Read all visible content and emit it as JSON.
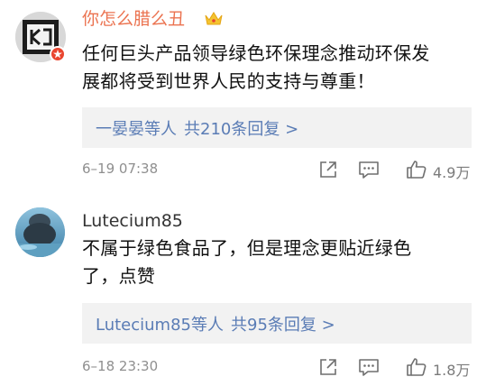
{
  "comments": [
    {
      "username": "你怎么腊么丑",
      "body_lines": [
        "任何巨头产品领导绿色环保理念推动环保发",
        "展都将受到世界人民的支持与尊重！"
      ],
      "reply_by": "一晏晏等人",
      "reply_count": "共210条回复 >",
      "time": "6–19 07:38",
      "likes": "4.9万"
    },
    {
      "username": "Lutecium85",
      "body_lines": [
        "不属于绿色食品了，但是理念更贴近绿色",
        "了，点赞"
      ],
      "reply_by": "Lutecium85等人",
      "reply_count": "共95条回复 >",
      "time": "6–18 23:30",
      "likes": "1.8万"
    }
  ],
  "colors": {
    "username_vip": "#eb7350",
    "link": "#5a7cb5",
    "meta": "#8f8f8f",
    "reply_bg": "#f2f2f2",
    "badge": "#e9452f"
  },
  "icons": [
    "avatar-frame-icon",
    "crown-icon",
    "share-icon",
    "comment-icon",
    "thumbs-up-icon"
  ]
}
